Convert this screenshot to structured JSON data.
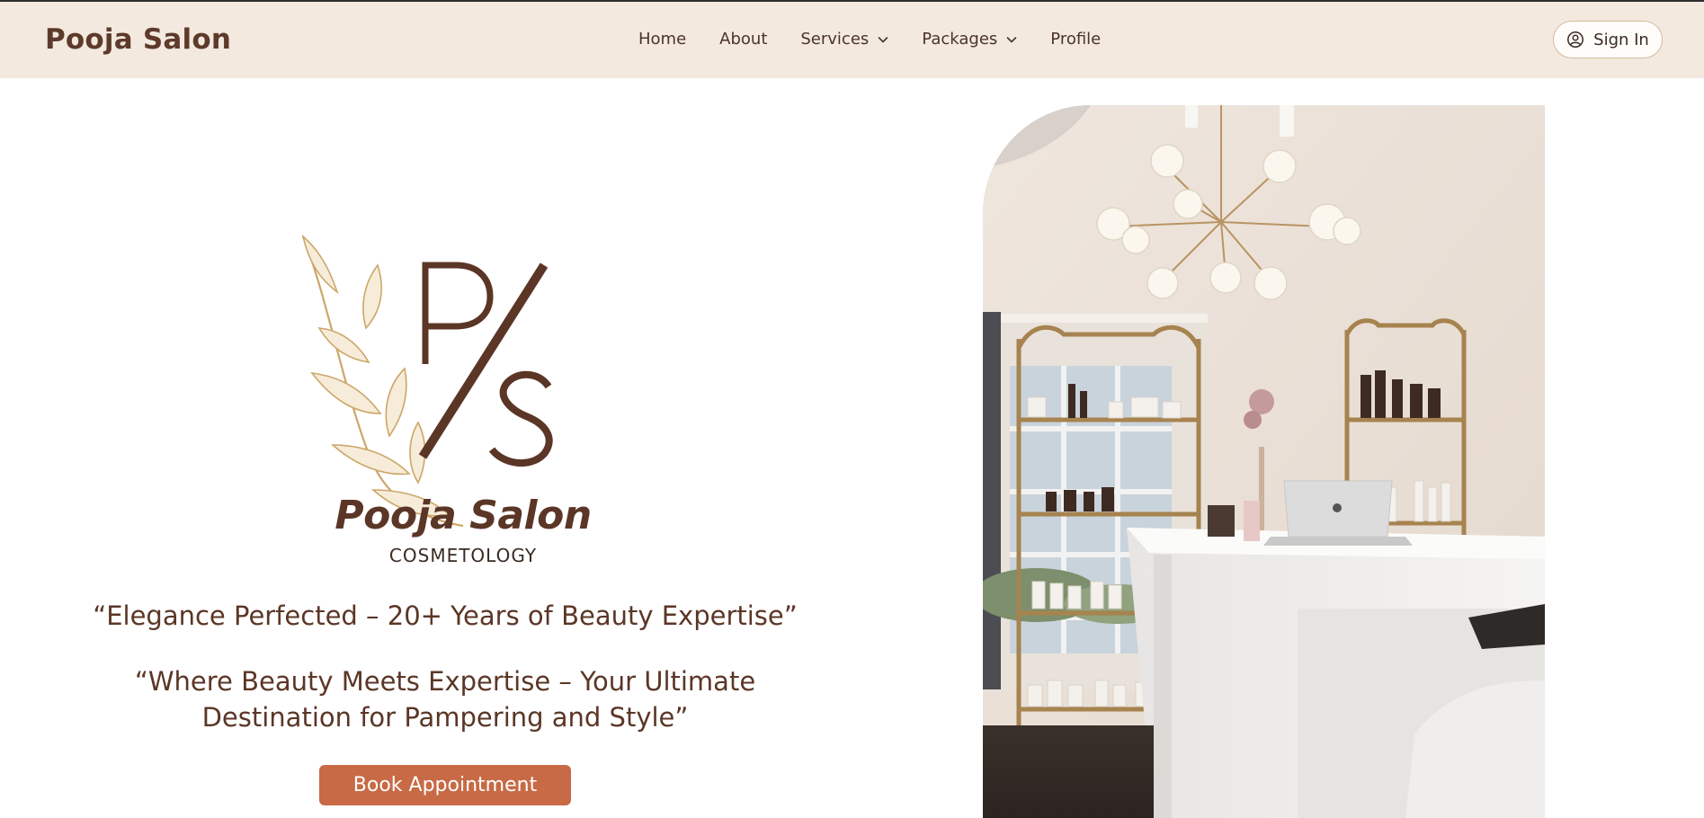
{
  "nav": {
    "brand": "Pooja Salon",
    "items": [
      {
        "label": "Home",
        "dropdown": false
      },
      {
        "label": "About",
        "dropdown": false
      },
      {
        "label": "Services",
        "dropdown": true
      },
      {
        "label": "Packages",
        "dropdown": true
      },
      {
        "label": "Profile",
        "dropdown": false
      }
    ],
    "signin_label": "Sign In"
  },
  "hero": {
    "logo_monogram": "P/S",
    "logo_name": "Pooja Salon",
    "logo_subtitle": "COSMETOLOGY",
    "tagline1": "“Elegance Perfected – 20+ Years of Beauty Expertise”",
    "tagline2": "“Where Beauty Meets Expertise – Your Ultimate Destination for Pampering and Style”",
    "cta_label": "Book Appointment"
  },
  "colors": {
    "nav_bg": "#f3e9df",
    "brand_brown": "#5b3626",
    "cta_bg": "#c76a45",
    "leaf_gold": "#cda668"
  },
  "icons": {
    "signin": "user-circle-icon",
    "dropdown": "chevron-down-icon"
  }
}
